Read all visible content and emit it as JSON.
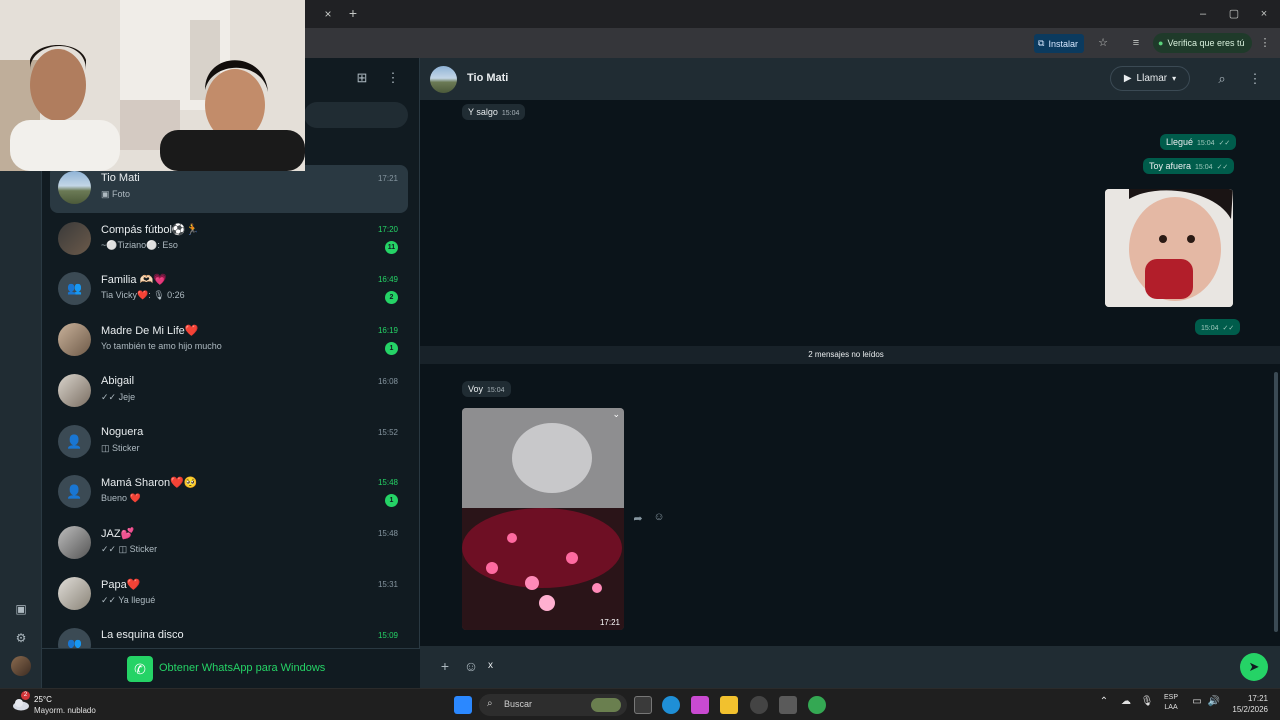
{
  "browser": {
    "tab_close": "×",
    "tab_new": "+",
    "install_label": "Instalar",
    "verify_label": "Verifica que eres tú",
    "win_minimize": "–",
    "win_restore": "▢",
    "win_close": "×"
  },
  "chats": [
    {
      "name": "Tio Mati",
      "preview": "▣ Foto",
      "time": "17:21",
      "unread": "",
      "active": true
    },
    {
      "name": "Compás fútbol⚽🏃",
      "preview": "~⚪Tiziano⚪: Eso",
      "time": "17:20",
      "unread": "11"
    },
    {
      "name": "Familia 🫶🏻💗",
      "preview": "Tia Vicky❤️: 🎙 0:26",
      "time": "16:49",
      "unread": "2"
    },
    {
      "name": "Madre De Mi Life❤️",
      "preview": "Yo también te amo hijo mucho",
      "time": "16:19",
      "unread": "1"
    },
    {
      "name": "Abigail",
      "preview": "✓✓ Jeje",
      "time": "16:08",
      "unread": ""
    },
    {
      "name": "Noguera",
      "preview": "◫ Sticker",
      "time": "15:52",
      "unread": ""
    },
    {
      "name": "Mamá Sharon❤️🥺",
      "preview": "Bueno ❤️",
      "time": "15:48",
      "unread": "1"
    },
    {
      "name": "JAZ💕",
      "preview": "✓✓ ◫ Sticker",
      "time": "15:48",
      "unread": ""
    },
    {
      "name": "Papa❤️",
      "preview": "✓✓ Ya llegué",
      "time": "15:31",
      "unread": ""
    },
    {
      "name": "La esquina disco",
      "preview": "",
      "time": "15:09",
      "unread": ""
    }
  ],
  "get_whatsapp": "Obtener WhatsApp para Windows",
  "conversation": {
    "contact_name": "Tio Mati",
    "call_label": "Llamar",
    "messages": [
      {
        "text": "Y salgo",
        "time": "15:04"
      },
      {
        "text": "Llegué",
        "time": "15:04"
      },
      {
        "text": "Toy afuera",
        "time": "15:04"
      },
      {
        "text": "",
        "time": "15:04"
      },
      {
        "text": "Voy",
        "time": "15:04"
      }
    ],
    "unread_divider": "2 mensajes no leídos",
    "photo_time": "17:21",
    "composer_text": "x"
  },
  "taskbar": {
    "temp": "25°C",
    "weather": "Mayorm. nublado",
    "weather_badge": "2",
    "search_label": "Buscar",
    "lang_top": "ESP",
    "lang_bottom": "LAA",
    "time": "17:21",
    "date": "15/2/2026"
  },
  "colors": {
    "accent": "#25d366",
    "outgoing_bubble": "#005c4b",
    "incoming_bubble": "#202c33"
  }
}
